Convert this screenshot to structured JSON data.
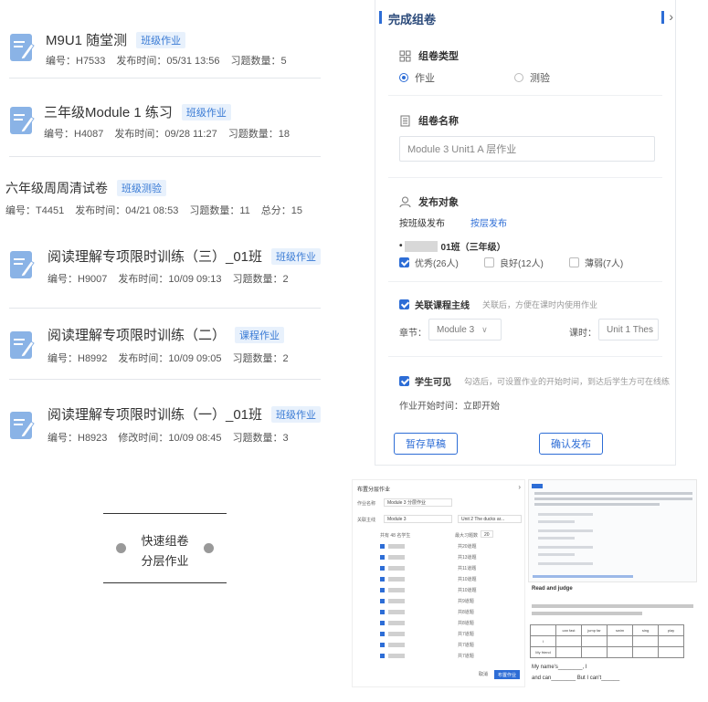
{
  "homework_list": [
    {
      "title": "M9U1 随堂测",
      "badge": "班级作业",
      "no": "编号：H7533",
      "time": "发布时间：05/31 13:56",
      "count": "习题数量：5",
      "extra": ""
    },
    {
      "title": "三年级Module 1 练习",
      "badge": "班级作业",
      "no": "编号：H4087",
      "time": "发布时间：09/28 11:27",
      "count": "习题数量：18",
      "extra": ""
    },
    {
      "title": "六年级周周清试卷",
      "badge": "班级测验",
      "no": "编号：T4451",
      "time": "发布时间：04/21 08:53",
      "count": "习题数量：11",
      "extra": "总分：15"
    },
    {
      "title": "阅读理解专项限时训练（三）_01班",
      "badge": "班级作业",
      "no": "编号：H9007",
      "time": "发布时间：10/09 09:13",
      "count": "习题数量：2",
      "extra": ""
    },
    {
      "title": "阅读理解专项限时训练（二）",
      "badge": "课程作业",
      "no": "编号：H8992",
      "time": "发布时间：10/09 09:05",
      "count": "习题数量：2",
      "extra": ""
    },
    {
      "title": "阅读理解专项限时训练（一）_01班",
      "badge": "班级作业",
      "no": "编号：H8923",
      "time": "修改时间：10/09 08:45",
      "count": "习题数量：3",
      "extra": ""
    }
  ],
  "publish_panel": {
    "title": "完成组卷",
    "close": "›",
    "type_label": "组卷类型",
    "type_options": [
      "作业",
      "测验"
    ],
    "name_label": "组卷名称",
    "name_value": "Module 3 Unit1 A 层作业",
    "target_label": "发布对象",
    "tab_class": "按班级发布",
    "tab_layer": "按层发布",
    "class_name": "01班（三年级）",
    "levels": [
      "优秀(26人)",
      "良好(12人)",
      "薄弱(7人)"
    ],
    "link_course_label": "关联课程主线",
    "link_course_hint": "关联后，方便在课时内使用作业",
    "chapter_label": "章节：",
    "chapter_value": "Module 3",
    "lesson_label": "课时：",
    "lesson_value": "Unit 1 Thes",
    "student_visible_label": "学生可见",
    "student_visible_hint": "勾选后，可设置作业的开始时间，到达后学生方可在线练",
    "start_time": "作业开始时间：立即开始",
    "save_draft": "暂存草稿",
    "confirm_publish": "确认发布"
  },
  "caption": {
    "line1": "快速组卷",
    "line2": "分层作业"
  },
  "thumb_students": {
    "title": "布置分层作业",
    "name_label": "作业名称",
    "name_value": "Module 3 分层作业",
    "course_label": "关联主线",
    "chapter_value": "Module 3",
    "lesson_value": "Unit 2 The ducks ar...",
    "total": "共有 48 名学生",
    "max_label": "最大习题数",
    "max_value": "20",
    "counts": [
      "共20道题",
      "共13道题",
      "共11道题",
      "共10道题",
      "共10道题",
      "共9道题",
      "共8道题",
      "共8道题",
      "共7道题",
      "共7道题",
      "共7道题"
    ],
    "cancel": "取消",
    "submit": "布置作业"
  },
  "thumb_worksheet": {
    "heading": "Read and judge",
    "row1": [
      "can fast",
      "jump far",
      "swim",
      "sing",
      "play"
    ],
    "row_labels": [
      "I",
      "My friend"
    ],
    "w1": "My name's________, I",
    "w2": "and can________   But I can't______"
  },
  "colors": {
    "accent": "#2d6dd6",
    "badge_bg": "#e8f1fc"
  }
}
